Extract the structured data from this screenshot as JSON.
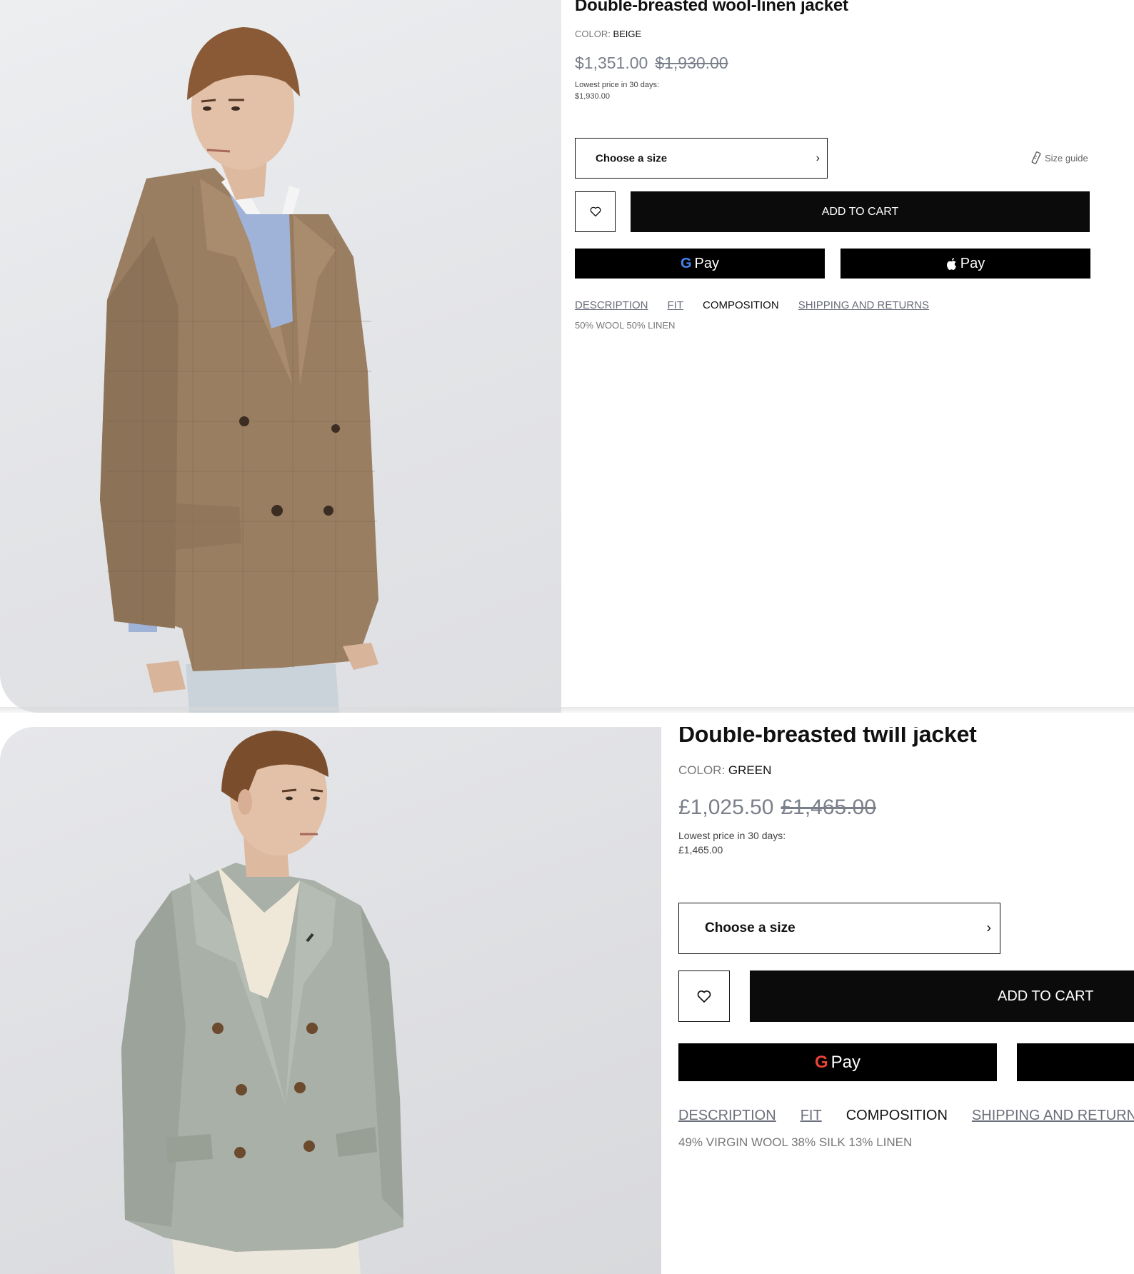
{
  "products": [
    {
      "title": "Double-breasted wool-linen jacket",
      "color_key": "COLOR:",
      "color_value": "BEIGE",
      "price_current": "$1,351.00",
      "price_original": "$1,930.00",
      "lowest_label": "Lowest price in 30 days:",
      "lowest_value": "$1,930.00",
      "size_select_label": "Choose a size",
      "size_guide_label": "Size guide",
      "add_to_cart_label": "ADD TO CART",
      "google_pay_g": "G",
      "google_pay_label": "Pay",
      "apple_pay_label": "Pay",
      "tabs": [
        "DESCRIPTION",
        "FIT",
        "COMPOSITION",
        "SHIPPING AND RETURNS"
      ],
      "active_tab": "COMPOSITION",
      "composition": "50% WOOL 50% LINEN",
      "image_alt": "model wearing beige checked double-breasted jacket"
    },
    {
      "title": "Double-breasted twill jacket",
      "color_key": "COLOR:",
      "color_value": "GREEN",
      "price_current": "£1,025.50",
      "price_original": "£1,465.00",
      "lowest_label": "Lowest price in 30 days:",
      "lowest_value": "£1,465.00",
      "size_select_label": "Choose a size",
      "add_to_cart_label": "ADD TO CART",
      "google_pay_g": "G",
      "google_pay_label": "Pay",
      "tabs": [
        "DESCRIPTION",
        "FIT",
        "COMPOSITION",
        "SHIPPING AND RETURNS"
      ],
      "active_tab": "COMPOSITION",
      "composition": "49% VIRGIN WOOL 38% SILK 13% LINEN",
      "image_alt": "model wearing sage green double-breasted jacket"
    }
  ],
  "colors": {
    "button_black": "#0b0b0b",
    "price_grey": "#7a7f8a",
    "jacket_beige": "#9a7e62",
    "jacket_green": "#a9b0a7"
  },
  "icons": {
    "wishlist": "heart-icon",
    "chevron": "chevron-right-icon",
    "size_guide": "ruler-icon",
    "apple": "apple-icon",
    "google": "google-g-icon"
  }
}
